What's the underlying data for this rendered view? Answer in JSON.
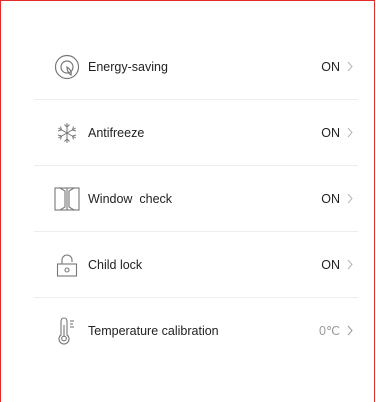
{
  "colors": {
    "frame_border": "#e32b2b",
    "text": "#222222",
    "muted_text": "#9a9a9a",
    "icon_stroke": "#777777",
    "divider": "#eeeeee"
  },
  "settings": [
    {
      "label": "Energy-saving",
      "value": "ON",
      "icon": "energy-saving-icon"
    },
    {
      "label": "Antifreeze",
      "value": "ON",
      "icon": "snowflake-icon"
    },
    {
      "label": "Window  check",
      "value": "ON",
      "icon": "window-icon"
    },
    {
      "label": "Child lock",
      "value": "ON",
      "icon": "lock-icon"
    },
    {
      "label": "Temperature calibration",
      "value": "0℃",
      "icon": "thermometer-icon"
    }
  ]
}
